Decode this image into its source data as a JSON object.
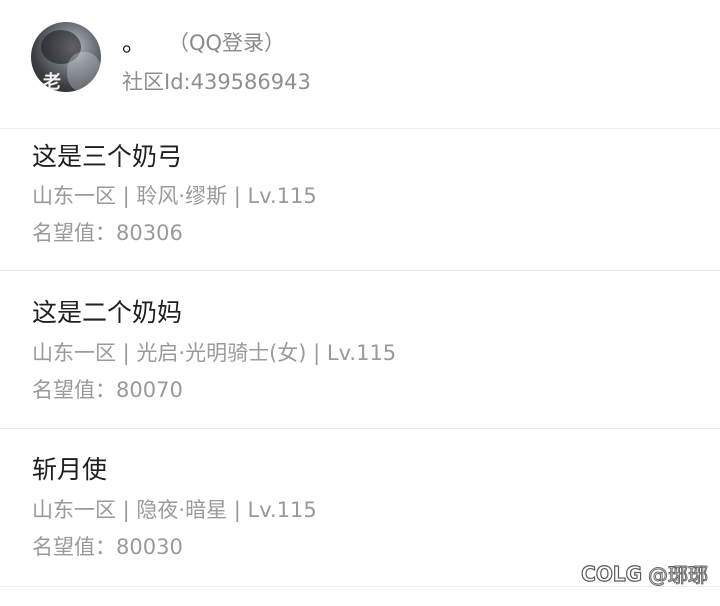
{
  "account": {
    "nickname": "。",
    "login_method": "（QQ登录）",
    "community_id": "社区Id:439586943",
    "avatar_glyph": "老"
  },
  "characters": [
    {
      "name": "这是三个奶弓",
      "info": "山东一区 | 聆风·缪斯 | Lv.115",
      "fame": "名望值：80306"
    },
    {
      "name": "这是二个奶妈",
      "info": "山东一区 | 光启·光明骑士(女) | Lv.115",
      "fame": "名望值：80070"
    },
    {
      "name": "斩月使",
      "info": "山东一区 | 隐夜·暗星 | Lv.115",
      "fame": "名望值：80030"
    }
  ],
  "watermark": {
    "logo": "COLG",
    "user": "@琊琊"
  }
}
